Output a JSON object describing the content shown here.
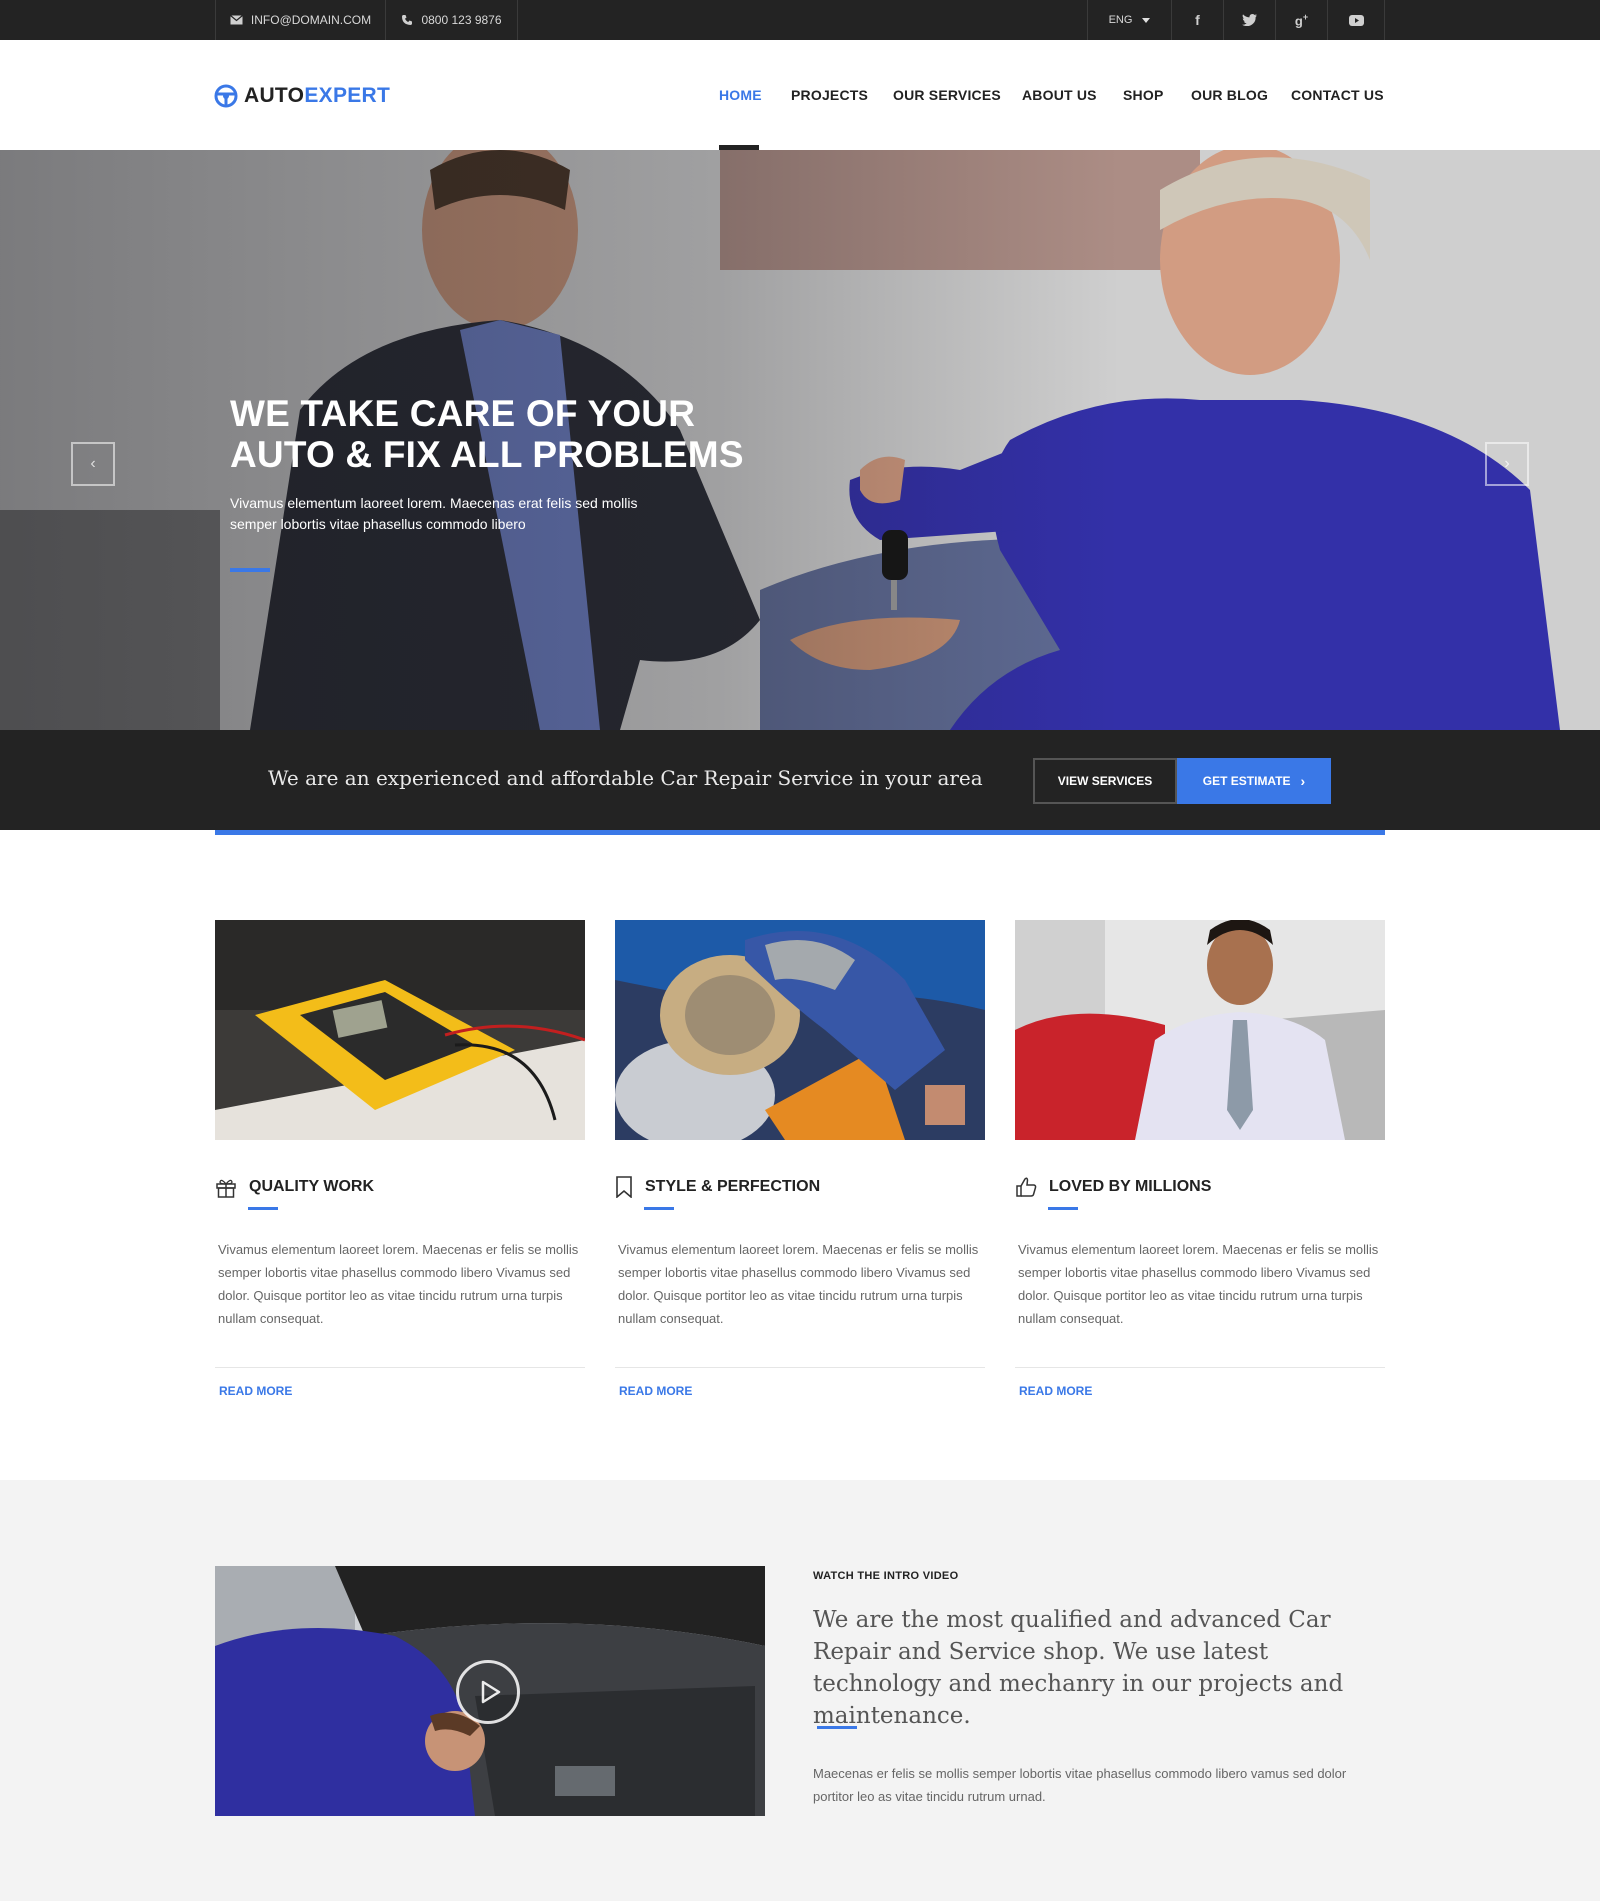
{
  "topbar": {
    "email": "INFO@DOMAIN.COM",
    "phone": "0800 123 9876",
    "language": "ENG",
    "social_icons": [
      "facebook-icon",
      "twitter-icon",
      "google-plus-icon",
      "youtube-icon"
    ]
  },
  "brand": {
    "logo_part1": "AUTO",
    "logo_part2": "EXPERT"
  },
  "nav": {
    "items": [
      {
        "label": "HOME",
        "active": true
      },
      {
        "label": "PROJECTS"
      },
      {
        "label": "OUR SERVICES"
      },
      {
        "label": "ABOUT US"
      },
      {
        "label": "SHOP"
      },
      {
        "label": "OUR BLOG"
      },
      {
        "label": "CONTACT US"
      }
    ]
  },
  "hero": {
    "title_line1": "WE TAKE CARE OF YOUR",
    "title_line2": "AUTO & FIX ALL PROBLEMS",
    "subtitle_line1": "Vivamus elementum laoreet lorem. Maecenas erat felis sed mollis",
    "subtitle_line2": "semper lobortis vitae phasellus commodo libero",
    "prev_icon": "chevron-left-icon",
    "next_icon": "chevron-right-icon"
  },
  "cta": {
    "text": "We are an experienced and affordable Car Repair Service in your area",
    "view_services": "VIEW SERVICES",
    "get_estimate": "GET ESTIMATE"
  },
  "features": [
    {
      "icon": "gift-icon",
      "title": "QUALITY WORK",
      "text": "Vivamus elementum laoreet lorem. Maecenas er felis se mollis semper lobortis vitae phasellus commodo libero Vivamus sed dolor. Quisque portitor leo as vitae tincidu rutrum urna turpis nullam consequat.",
      "link": "READ MORE"
    },
    {
      "icon": "bookmark-icon",
      "title": "STYLE & PERFECTION",
      "text": "Vivamus elementum laoreet lorem. Maecenas er felis se mollis semper lobortis vitae phasellus commodo libero Vivamus sed dolor. Quisque portitor leo as vitae tincidu rutrum urna turpis nullam consequat.",
      "link": "READ MORE"
    },
    {
      "icon": "thumbs-up-icon",
      "title": "LOVED BY MILLIONS",
      "text": "Vivamus elementum laoreet lorem. Maecenas er felis se mollis semper lobortis vitae phasellus commodo libero Vivamus sed dolor. Quisque portitor leo as vitae tincidu rutrum urna turpis nullam consequat.",
      "link": "READ MORE"
    }
  ],
  "intro": {
    "kicker": "WATCH THE INTRO VIDEO",
    "heading": "We are the most qualified and advanced Car Repair and Service shop. We use latest technology and mechanry in our projects and maintenance.",
    "text": "Maecenas er felis se mollis semper lobortis vitae phasellus commodo libero vamus sed dolor portitor leo as vitae tincidu rutrum urnad.",
    "play_icon": "play-icon"
  },
  "colors": {
    "accent": "#3a78e7",
    "dark": "#232323",
    "light_bg": "#f3f3f3"
  }
}
